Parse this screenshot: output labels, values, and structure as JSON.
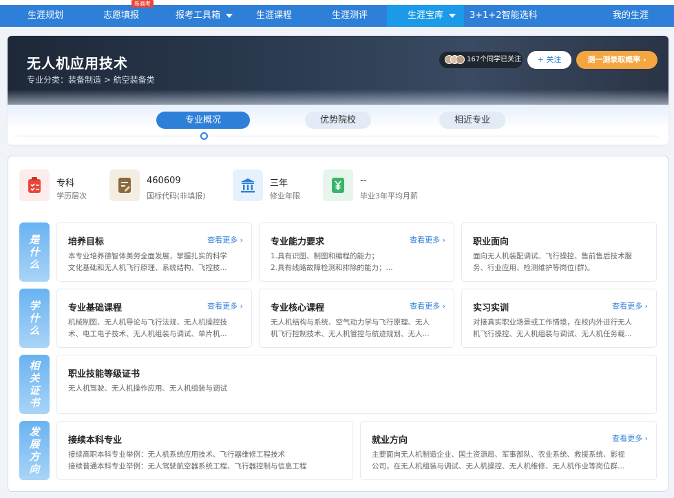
{
  "nav": {
    "items": [
      {
        "label": "生涯规划"
      },
      {
        "label": "志愿填报"
      },
      {
        "label": "报考工具箱"
      },
      {
        "label": "生涯课程"
      },
      {
        "label": "生涯测评"
      },
      {
        "label": "生涯宝库"
      },
      {
        "label": "3+1+2智能选科"
      },
      {
        "label": "我的生涯"
      }
    ],
    "badge": "新高考"
  },
  "major": {
    "title": "无人机应用技术",
    "category": "专业分类：装备制造 > 航空装备类",
    "followers": "167个同学已关注",
    "follow_label": "+ 关注",
    "test_label": "测一测录取概率 ›"
  },
  "tabs": [
    {
      "label": "专业概况"
    },
    {
      "label": "优势院校"
    },
    {
      "label": "相近专业"
    }
  ],
  "stats": [
    {
      "value": "专科",
      "label": "学历层次",
      "icon": "clipboard-icon",
      "color": "#e8463a"
    },
    {
      "value": "460609",
      "label": "国标代码(非填报)",
      "icon": "document-edit-icon",
      "color": "#8a6a3c"
    },
    {
      "value": "三年",
      "label": "修业年限",
      "icon": "institution-icon",
      "color": "#2e7fd8"
    },
    {
      "value": "--",
      "label": "毕业3年平均月薪",
      "icon": "money-icon",
      "color": "#3bb36b"
    }
  ],
  "sections": [
    {
      "label": [
        "是",
        "什",
        "么"
      ]
    },
    {
      "label": [
        "学",
        "什",
        "么"
      ]
    },
    {
      "label": [
        "相",
        "关",
        "证",
        "书"
      ]
    },
    {
      "label": [
        "发",
        "展",
        "方",
        "向"
      ]
    }
  ],
  "more_label": "查看更多 ›",
  "cards": {
    "goal": {
      "title": "培养目标",
      "lines": [
        "本专业培养德智体美劳全面发展，掌握扎实的科学",
        "文化基础和无人机飞行原理、系统结构、飞控技..."
      ]
    },
    "ability": {
      "title": "专业能力要求",
      "lines": [
        "1.具有识图、制图和编程的能力；",
        "2.具有线路故障检测和排除的能力；..."
      ]
    },
    "career": {
      "title": "职业面向",
      "lines": [
        "面向无人机装配调试、飞行操控、售前售后技术服",
        "务、行业应用、检测维护等岗位(群)。"
      ]
    },
    "basic": {
      "title": "专业基础课程",
      "lines": [
        "机械制图、无人机导论与飞行法规、无人机操控技",
        "术、电工电子技术、无人机组装与调试、单片机..."
      ]
    },
    "core": {
      "title": "专业核心课程",
      "lines": [
        "无人机结构与系统、空气动力学与飞行原理、无人",
        "机飞行控制技术、无人机管控与航迹规划、无人..."
      ]
    },
    "practice": {
      "title": "实习实训",
      "lines": [
        "对接真实职业场景或工作情境，在校内外进行无人",
        "机飞行操控、无人机组装与调试、无人机任务载..."
      ]
    },
    "cert": {
      "title": "职业技能等级证书",
      "lines": [
        "无人机驾驶、无人机操作应用、无人机组装与调试"
      ]
    },
    "further": {
      "title": "接续本科专业",
      "lines": [
        "接续高职本科专业举例：无人机系统应用技术、飞行器维修工程技术",
        "接续普通本科专业举例：无人驾驶航空器系统工程、飞行器控制与信息工程"
      ]
    },
    "direction": {
      "title": "就业方向",
      "lines": [
        "主要面向无人机制造企业、国土资源局、军事部队、农业系统、救援系统、影视",
        "公司，在无人机组装与调试、无人机操控、无人机维修、无人机作业等岗位群..."
      ]
    }
  }
}
